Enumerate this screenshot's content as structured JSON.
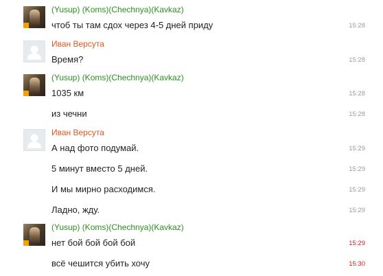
{
  "colors": {
    "sender_yusup": "#2a8f1f",
    "sender_ivan": "#e0571e",
    "timestamp": "#9a9a9a",
    "timestamp_unread": "#d21d1d",
    "message_text": "#222222"
  },
  "chat": {
    "groups": [
      {
        "sender": "(Yusup) (Koms)(Chechnya)(Kavkaz)",
        "avatar": "photo",
        "messages": [
          {
            "text": "чтоб ты там сдох через 4-5 дней приду",
            "time": "15:28",
            "unread": false
          }
        ]
      },
      {
        "sender": "Иван Версута",
        "avatar": "placeholder",
        "messages": [
          {
            "text": "Время?",
            "time": "15:28",
            "unread": false
          }
        ]
      },
      {
        "sender": "(Yusup) (Koms)(Chechnya)(Kavkaz)",
        "avatar": "photo",
        "messages": [
          {
            "text": "1035 км",
            "time": "15:28",
            "unread": false
          },
          {
            "text": "из чечни",
            "time": "15:28",
            "unread": false
          }
        ]
      },
      {
        "sender": "Иван Версута",
        "avatar": "placeholder",
        "messages": [
          {
            "text": "А над фото подумай.",
            "time": "15:29",
            "unread": false
          },
          {
            "text": "5 минут вместо 5 дней.",
            "time": "15:29",
            "unread": false
          },
          {
            "text": "И мы мирно расходимся.",
            "time": "15:29",
            "unread": false
          },
          {
            "text": "Ладно, жду.",
            "time": "15:29",
            "unread": false
          }
        ]
      },
      {
        "sender": "(Yusup) (Koms)(Chechnya)(Kavkaz)",
        "avatar": "photo",
        "messages": [
          {
            "text": "нет бой бой бой  бой",
            "time": "15:29",
            "unread": true
          },
          {
            "text": "всё чешится убить хочу",
            "time": "15:30",
            "unread": true
          }
        ]
      }
    ]
  }
}
